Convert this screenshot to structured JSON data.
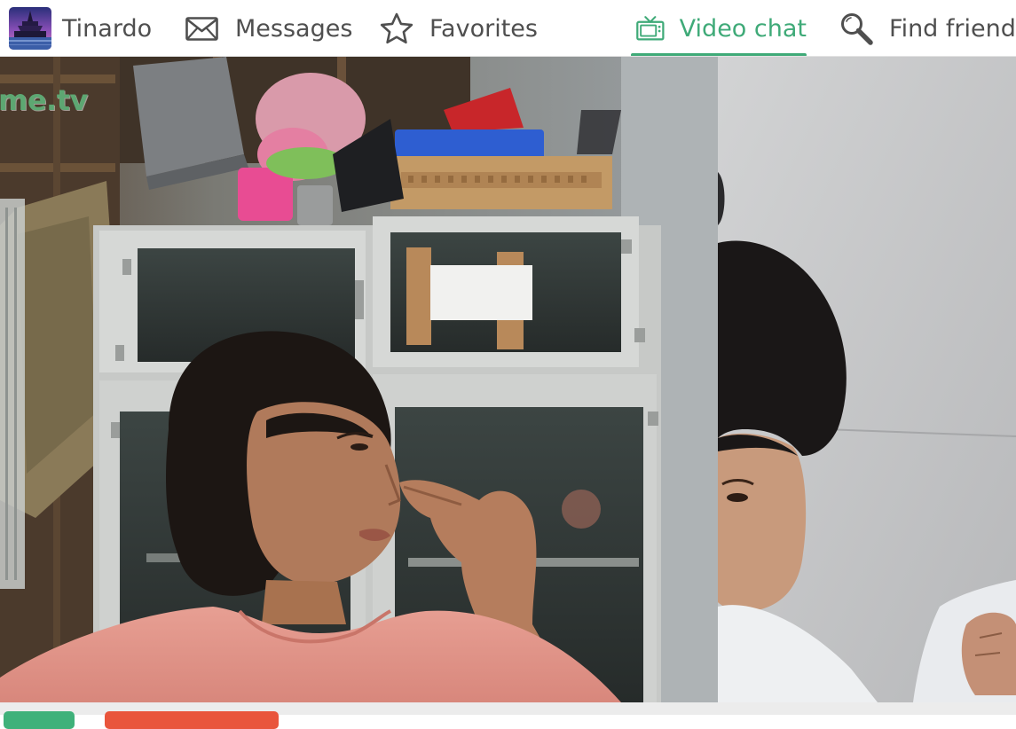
{
  "nav": {
    "profile": {
      "name": "Tinardo",
      "avatar_icon": "palace-avatar"
    },
    "messages": {
      "label": "Messages",
      "icon": "envelope-icon"
    },
    "favorites": {
      "label": "Favorites",
      "icon": "star-icon"
    },
    "video_chat": {
      "label": "Video chat",
      "icon": "tv-icon",
      "active": true
    },
    "find_friends": {
      "label": "Find friends",
      "icon": "magnifier-icon"
    }
  },
  "video": {
    "watermark": "me.tv"
  },
  "colors": {
    "accent": "#3faa78",
    "nav_text": "#4f4f4f",
    "control_green": "#3fb17a",
    "control_red": "#e9553c"
  }
}
